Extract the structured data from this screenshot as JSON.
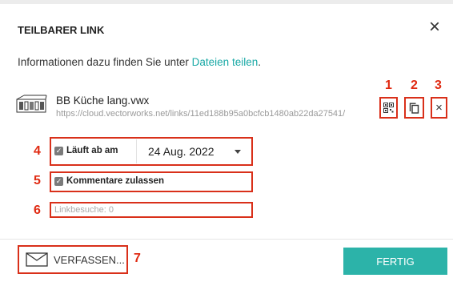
{
  "dialog": {
    "title": "TEILBARER LINK",
    "info_text": "Informationen dazu finden Sie unter ",
    "info_link": "Dateien teilen",
    "info_suffix": "."
  },
  "file": {
    "name": "BB Küche lang.vwx",
    "url": "https://cloud.vectorworks.net/links/11ed188b95a0bcfcb1480ab22da27541/"
  },
  "options": {
    "expires_label": "Läuft ab am",
    "expires_checked": true,
    "expires_date": "24 Aug. 2022",
    "comments_label": "Kommentare zulassen",
    "comments_checked": true,
    "visits_text": "Linkbesuche: 0"
  },
  "footer": {
    "compose_label": "VERFASSEN...",
    "done_label": "FERTIG"
  },
  "annotations": {
    "n1": "1",
    "n2": "2",
    "n3": "3",
    "n4": "4",
    "n5": "5",
    "n6": "6",
    "n7": "7"
  },
  "icons": [
    "qr-code-icon",
    "copy-icon",
    "remove-link-icon",
    "close-icon",
    "mail-icon",
    "dropdown-caret-icon",
    "checkbox-check-icon"
  ],
  "colors": {
    "accent": "#1aa9a6",
    "done_button": "#2cb3a9",
    "annotation_red": "#e02a12"
  }
}
